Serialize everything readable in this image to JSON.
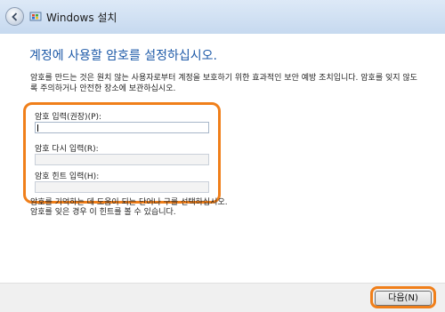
{
  "window": {
    "title": "Windows 설치"
  },
  "page": {
    "title": "계정에 사용할 암호를 설정하십시오.",
    "description": "암호를 만드는 것은 원치 않는 사용자로부터 계정을 보호하기 위한 효과적인 보안 예방 조치입니다. 암호를 잊지 않도록 주의하거나 안전한 장소에 보관하십시오."
  },
  "fields": {
    "password_label": "암호 입력(권장)(P):",
    "password_value": "",
    "confirm_label": "암호 다시 입력(R):",
    "confirm_value": "",
    "hint_label": "암호 힌트 입력(H):",
    "hint_value": ""
  },
  "hint_text": {
    "line1": "암호를 기억하는 데 도움이 되는 단어나 구를 선택하십시오.",
    "line2": "암호를 잊은 경우 이 힌트를 볼 수 있습니다."
  },
  "footer": {
    "next_label": "다음(N)"
  },
  "colors": {
    "highlight": "#f07f1a",
    "title_blue": "#1e5aa8"
  },
  "icons": {
    "back": "back-arrow-icon",
    "app": "windows-setup-icon"
  }
}
